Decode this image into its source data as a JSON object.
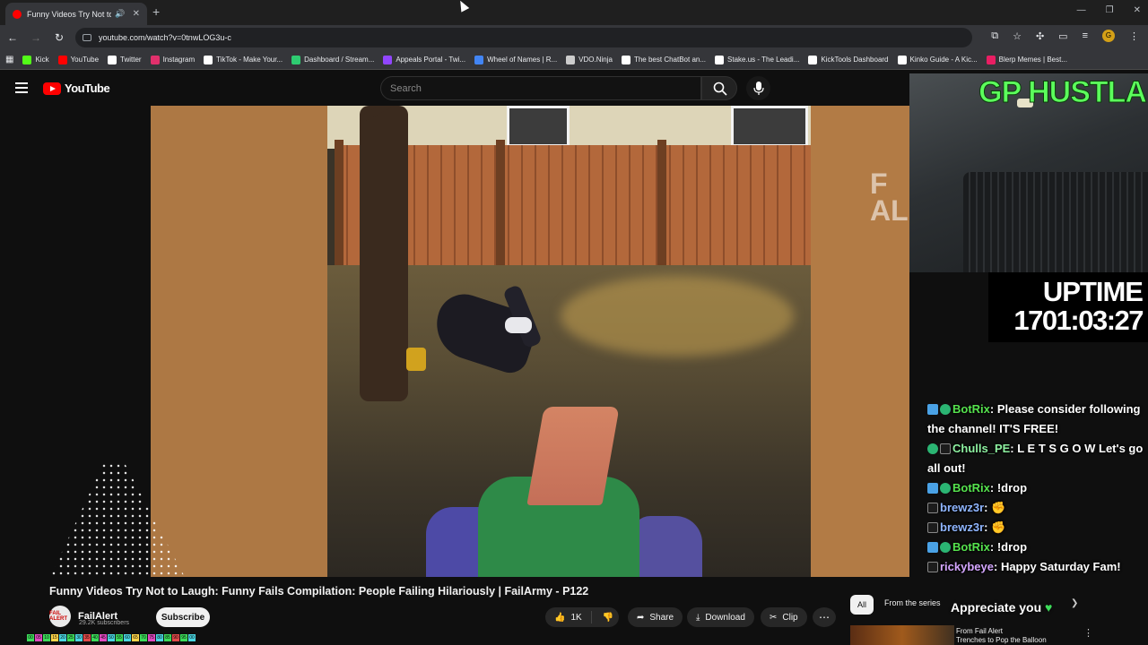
{
  "browser": {
    "tab_title": "Funny Videos Try Not to La",
    "url": "youtube.com/watch?v=0tnwLOG3u-c",
    "bookmarks": [
      {
        "label": "Kick",
        "color": "#53fc18"
      },
      {
        "label": "YouTube",
        "color": "#ff0000"
      },
      {
        "label": "Twitter",
        "color": "#ffffff"
      },
      {
        "label": "Instagram",
        "color": "#e1306c"
      },
      {
        "label": "TikTok - Make Your...",
        "color": "#ffffff"
      },
      {
        "label": "Dashboard / Stream...",
        "color": "#2ecc71"
      },
      {
        "label": "Appeals Portal - Twi...",
        "color": "#9146ff"
      },
      {
        "label": "Wheel of Names | R...",
        "color": "#4285f4"
      },
      {
        "label": "VDO.Ninja",
        "color": "#cccccc"
      },
      {
        "label": "The best ChatBot an...",
        "color": "#ffffff"
      },
      {
        "label": "Stake.us - The Leadi...",
        "color": "#ffffff"
      },
      {
        "label": "KickTools Dashboard",
        "color": "#ffffff"
      },
      {
        "label": "Kinko Guide - A Kic...",
        "color": "#ffffff"
      },
      {
        "label": "Blerp Memes | Best...",
        "color": "#e91e63"
      }
    ],
    "profile_initial": "G"
  },
  "youtube": {
    "logo_text": "YouTube",
    "search_placeholder": "Search",
    "video_watermark": "F\nAL",
    "video_title": "Funny Videos Try Not to Laugh: Funny Fails Compilation: People Failing Hilariously | FailArmy - P122",
    "channel_name": "FailAlert",
    "channel_avatar_text": "FAIL ALERT",
    "subscribers": "29.2K subscribers",
    "subscribe_label": "Subscribe",
    "like_count": "1K",
    "share_label": "Share",
    "download_label": "Download",
    "clip_label": "Clip",
    "chip_all": "All",
    "chip_series": "From the series",
    "related_channel": "From Fail Alert",
    "related_title": "Trenches to Pop the Balloon"
  },
  "stream": {
    "banner": "GP HUSTLA",
    "uptime_label": "UPTIME",
    "uptime_value": "1701:03:27",
    "appreciate": "Appreciate you",
    "chat": [
      {
        "user": "BotRix",
        "cls": "name-bot",
        "badges": [
          "bot",
          "ver"
        ],
        "text": ": Please consider following the channel! IT'S FREE!"
      },
      {
        "user": "Chulls_PE",
        "cls": "name-chulls",
        "badges": [
          "ver",
          "mod"
        ],
        "text": ": L E T S G O W Let's go all out!"
      },
      {
        "user": "BotRix",
        "cls": "name-bot",
        "badges": [
          "bot",
          "ver"
        ],
        "text": ": !drop"
      },
      {
        "user": "brewz3r",
        "cls": "name-brew",
        "badges": [
          "mod"
        ],
        "text": ": ✊"
      },
      {
        "user": "brewz3r",
        "cls": "name-brew",
        "badges": [
          "mod"
        ],
        "text": ": ✊"
      },
      {
        "user": "BotRix",
        "cls": "name-bot",
        "badges": [
          "bot",
          "ver"
        ],
        "text": ": !drop"
      },
      {
        "user": "rickybeye",
        "cls": "name-ricky",
        "badges": [
          "mod"
        ],
        "text": ": Happy Saturday Fam!"
      }
    ]
  },
  "color_strip": [
    "00",
    "05",
    "10",
    "15",
    "20",
    "25",
    "30",
    "35",
    "40",
    "45",
    "50",
    "55",
    "60",
    "65",
    "70",
    "75",
    "80",
    "85",
    "90",
    "95",
    "00"
  ]
}
